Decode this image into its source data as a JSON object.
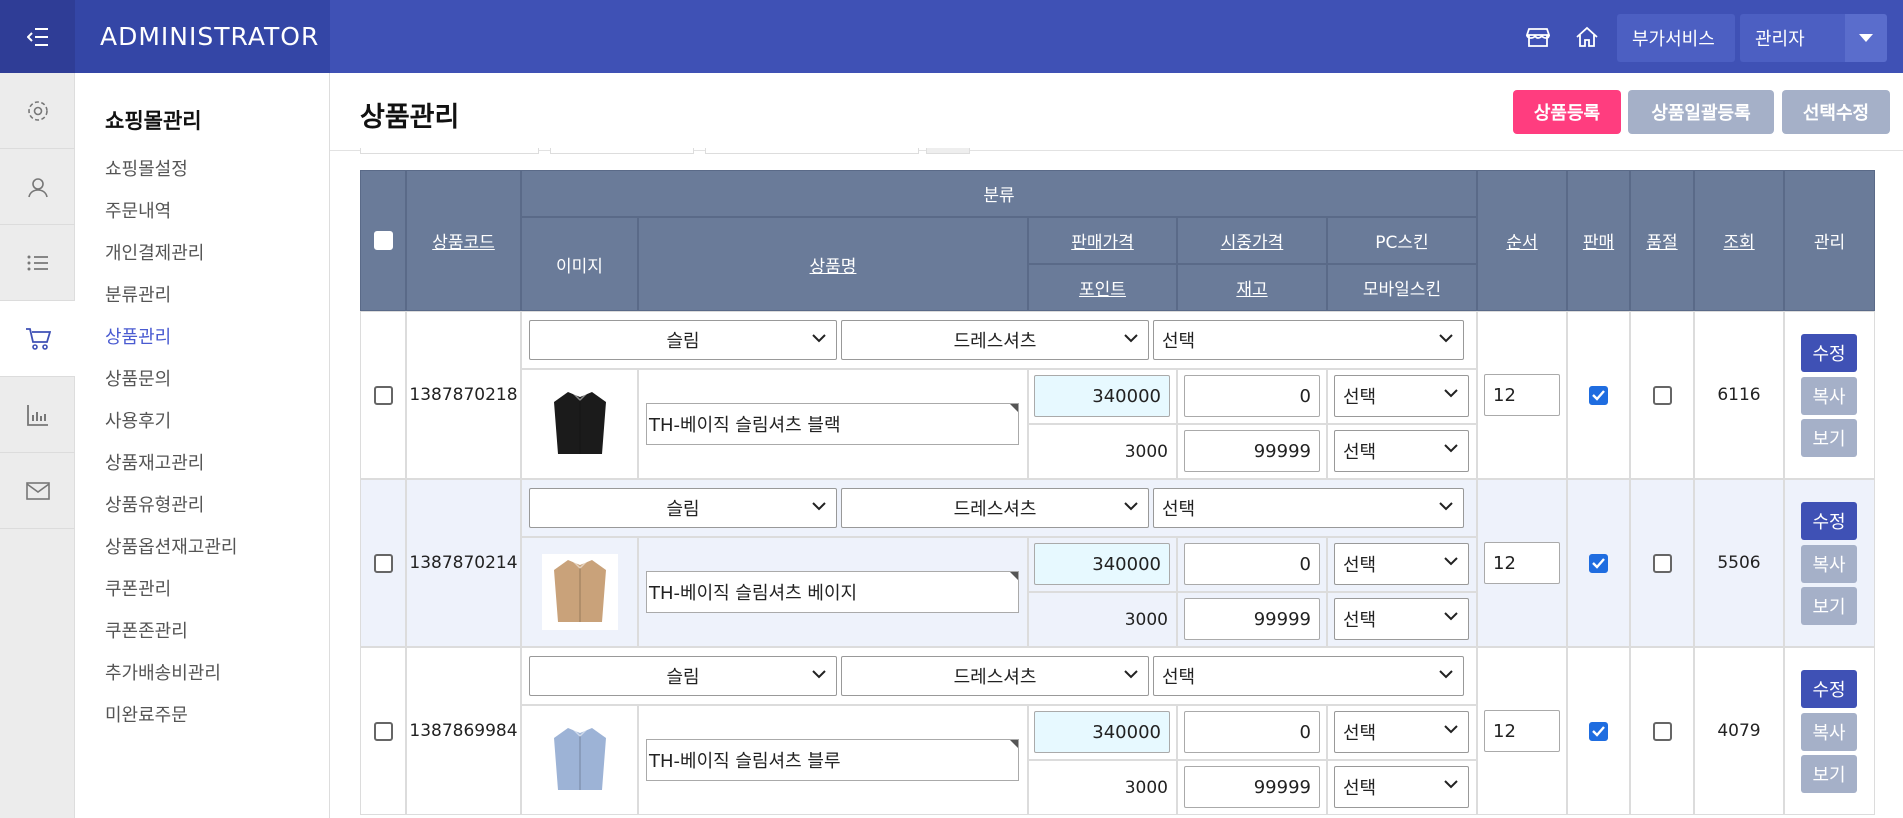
{
  "topbar": {
    "brand": "ADMINISTRATOR",
    "addon_label": "부가서비스",
    "user_label": "관리자",
    "icons": [
      "menu-collapse-icon",
      "store-icon",
      "home-icon",
      "caret-down-icon"
    ]
  },
  "iconbar": {
    "items": [
      "gear-icon",
      "user-icon",
      "list-icon",
      "cart-icon",
      "chart-icon",
      "mail-icon"
    ]
  },
  "sidebar": {
    "title": "쇼핑몰관리",
    "items": [
      "쇼핑몰설정",
      "주문내역",
      "개인결제관리",
      "분류관리",
      "상품관리",
      "상품문의",
      "사용후기",
      "상품재고관리",
      "상품유형관리",
      "상품옵션재고관리",
      "쿠폰관리",
      "쿠폰존관리",
      "추가배송비관리",
      "미완료주문"
    ],
    "active_index": 4
  },
  "header": {
    "title": "상품관리",
    "btn_register": "상품등록",
    "btn_bulk": "상품일괄등록",
    "btn_edit_sel": "선택수정"
  },
  "colors": {
    "topbar": "#3f51b5",
    "accent_pink": "#ff3d7f",
    "header_gray": "#a5b0c8",
    "table_head": "#6a7b99",
    "price_highlight": "#e7f9ff"
  },
  "table": {
    "headers": {
      "code": "상품코드",
      "category": "분류",
      "image": "이미지",
      "name": "상품명",
      "price": "판매가격",
      "market_price": "시중가격",
      "pc_skin": "PC스킨",
      "point": "포인트",
      "stock": "재고",
      "mobile_skin": "모바일스킨",
      "order": "순서",
      "sale": "판매",
      "soldout": "품절",
      "views": "조회",
      "manage": "관리"
    },
    "rows": [
      {
        "code": "1387870218",
        "cat1": "슬림",
        "cat2": "드레스셔츠",
        "cat3": "선택",
        "name": "TH-베이직 슬림셔츠 블랙",
        "shirt_color": "#1b1b1b",
        "price": "340000",
        "market_price": "0",
        "pc_skin": "선택",
        "point": "3000",
        "stock": "99999",
        "mobile_skin": "선택",
        "order": "12",
        "sale": true,
        "soldout": false,
        "views": "6116",
        "btn_edit": "수정",
        "btn_copy": "복사",
        "btn_view": "보기"
      },
      {
        "code": "1387870214",
        "cat1": "슬림",
        "cat2": "드레스셔츠",
        "cat3": "선택",
        "name": "TH-베이직 슬림셔츠 베이지",
        "shirt_color": "#c9a27a",
        "price": "340000",
        "market_price": "0",
        "pc_skin": "선택",
        "point": "3000",
        "stock": "99999",
        "mobile_skin": "선택",
        "order": "12",
        "sale": true,
        "soldout": false,
        "views": "5506",
        "btn_edit": "수정",
        "btn_copy": "복사",
        "btn_view": "보기"
      },
      {
        "code": "1387869984",
        "cat1": "슬림",
        "cat2": "드레스셔츠",
        "cat3": "선택",
        "name": "TH-베이직 슬림셔츠 블루",
        "shirt_color": "#9db3d6",
        "price": "340000",
        "market_price": "0",
        "pc_skin": "선택",
        "point": "3000",
        "stock": "99999",
        "mobile_skin": "선택",
        "order": "12",
        "sale": true,
        "soldout": false,
        "views": "4079",
        "btn_edit": "수정",
        "btn_copy": "복사",
        "btn_view": "보기"
      }
    ]
  }
}
